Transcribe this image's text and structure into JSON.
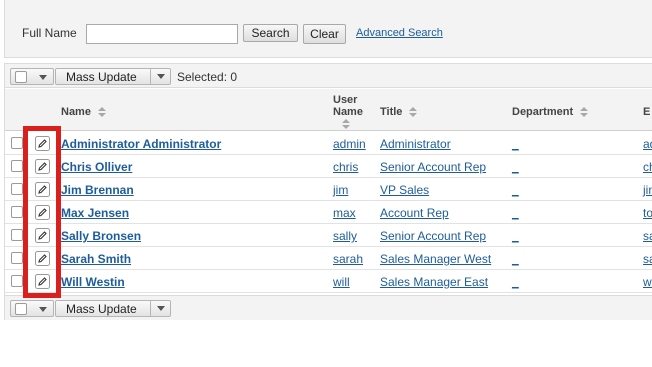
{
  "search": {
    "label": "Full Name",
    "value": "",
    "placeholder": "",
    "search_button": "Search",
    "clear_button": "Clear",
    "advanced_link": "Advanced Search"
  },
  "toolbar": {
    "mass_update": "Mass Update",
    "selected_text": "Selected: 0"
  },
  "columns": {
    "name": "Name",
    "user_line1": "User",
    "user_line2": "Name",
    "title": "Title",
    "department": "Department",
    "email_partial": "E"
  },
  "rows": [
    {
      "name": "Administrator Administrator",
      "user": "admin",
      "title": "Administrator",
      "dept": "_",
      "email": "ad"
    },
    {
      "name": "Chris Olliver",
      "user": "chris",
      "title": "Senior Account Rep",
      "dept": "_",
      "email": "ch"
    },
    {
      "name": "Jim Brennan",
      "user": "jim",
      "title": "VP Sales",
      "dept": "_",
      "email": "jin"
    },
    {
      "name": "Max Jensen",
      "user": "max",
      "title": "Account Rep",
      "dept": "_",
      "email": "to"
    },
    {
      "name": "Sally Bronsen",
      "user": "sally",
      "title": "Senior Account Rep",
      "dept": "_",
      "email": "sa"
    },
    {
      "name": "Sarah Smith",
      "user": "sarah",
      "title": "Sales Manager West",
      "dept": "_",
      "email": "sa"
    },
    {
      "name": "Will Westin",
      "user": "will",
      "title": "Sales Manager East",
      "dept": "_",
      "email": "wi"
    }
  ],
  "colors": {
    "link": "#1d5d9b",
    "highlight": "#d9201c",
    "panel_bg": "#f3f3f3"
  },
  "icons": {
    "row_edit": "pencil-edit-icon",
    "sort": "sort-arrows-icon",
    "dropdown": "chevron-down-icon"
  }
}
